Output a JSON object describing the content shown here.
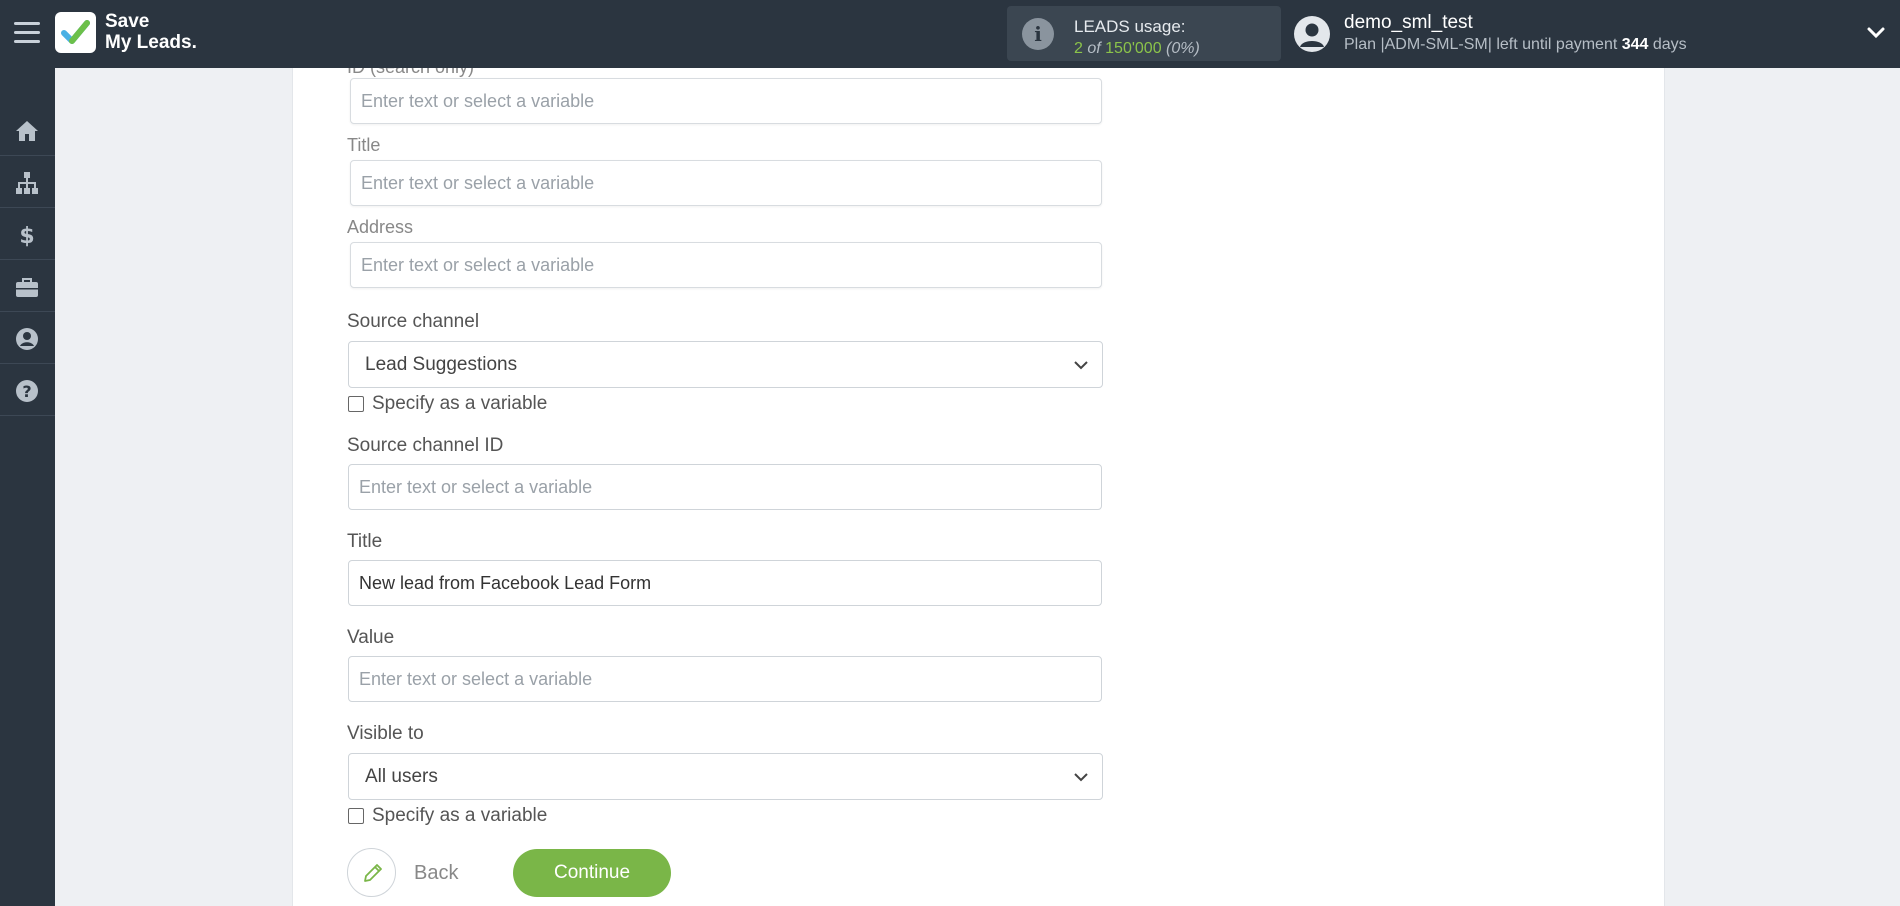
{
  "app": {
    "logo_line1": "Save",
    "logo_line2": "My Leads."
  },
  "usage": {
    "title": "LEADS usage:",
    "used": "2",
    "of": " of ",
    "total": "150'000",
    "percent": "(0%)"
  },
  "user": {
    "name": "demo_sml_test",
    "plan_prefix": "Plan |ADM-SML-SM| left until payment ",
    "days": "344",
    "days_suffix": " days"
  },
  "sidebar": {
    "items": [
      {
        "icon": "home-icon"
      },
      {
        "icon": "sitemap-icon"
      },
      {
        "icon": "dollar-icon"
      },
      {
        "icon": "briefcase-icon"
      },
      {
        "icon": "user-circle-icon"
      },
      {
        "icon": "help-icon"
      }
    ]
  },
  "form": {
    "partial_label": "ID (search only)",
    "id_placeholder": "Enter text or select a variable",
    "title_light_label": "Title",
    "title_light_placeholder": "Enter text or select a variable",
    "address_label": "Address",
    "address_placeholder": "Enter text or select a variable",
    "source_channel_label": "Source channel",
    "source_channel_value": "Lead Suggestions",
    "specify_variable_1": "Specify as a variable",
    "source_channel_id_label": "Source channel ID",
    "source_channel_id_placeholder": "Enter text or select a variable",
    "title_label": "Title",
    "title_value": "New lead from Facebook Lead Form",
    "value_label": "Value",
    "value_placeholder": "Enter text or select a variable",
    "visible_to_label": "Visible to",
    "visible_to_value": "All users",
    "specify_variable_2": "Specify as a variable"
  },
  "buttons": {
    "back": "Back",
    "continue": "Continue"
  },
  "colors": {
    "topbar": "#2b3540",
    "accent_green": "#7ab648",
    "usage_green": "#8bc34a"
  }
}
